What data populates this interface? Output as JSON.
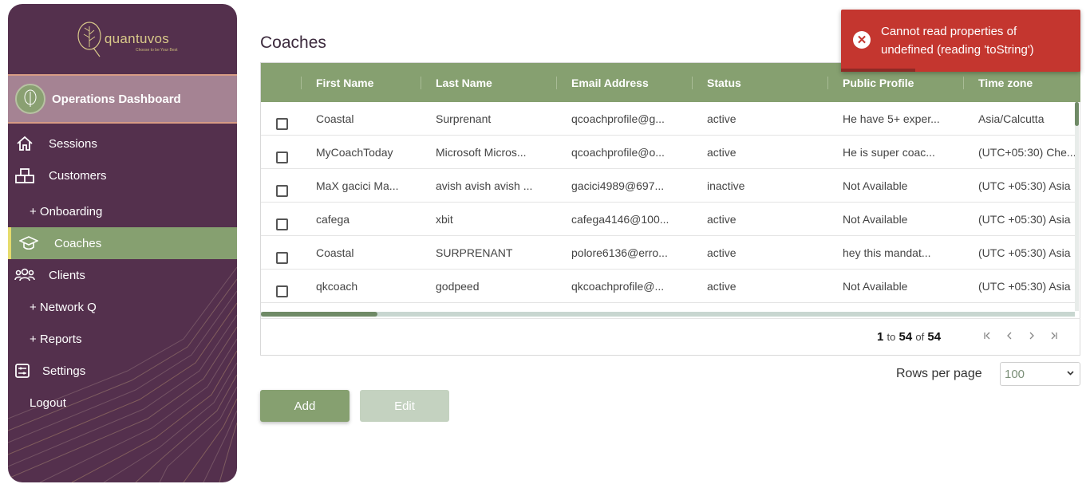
{
  "app": {
    "brand": "quantuvos",
    "tagline": "Choose to be Your Best"
  },
  "sidebar": {
    "dashboard_label": "Operations Dashboard",
    "items": [
      {
        "label": "Sessions",
        "icon": "home-icon"
      },
      {
        "label": "Customers",
        "icon": "building-icon"
      },
      {
        "label": "+ Onboarding",
        "icon": ""
      },
      {
        "label": "Coaches",
        "icon": "graduation-cap-icon"
      },
      {
        "label": "Clients",
        "icon": "users-icon"
      },
      {
        "label": "+ Network Q",
        "icon": ""
      },
      {
        "label": "+ Reports",
        "icon": ""
      },
      {
        "label": "Settings",
        "icon": "settings-icon"
      },
      {
        "label": "Logout",
        "icon": ""
      }
    ]
  },
  "page": {
    "title": "Coaches"
  },
  "table": {
    "columns": [
      "First Name",
      "Last Name",
      "Email Address",
      "Status",
      "Public Profile",
      "Time zone"
    ],
    "rows": [
      [
        "Coastal",
        "Surprenant",
        "qcoachprofile@g...",
        "active",
        "He have 5+ exper...",
        "Asia/Calcutta"
      ],
      [
        "MyCoachToday",
        "Microsoft Micros...",
        "qcoachprofile@o...",
        "active",
        "He is super coac...",
        "(UTC+05:30) Che..."
      ],
      [
        "MaX gacici Ma...",
        "avish avish avish ...",
        "gacici4989@697...",
        "inactive",
        "Not Available",
        "(UTC +05:30) Asia"
      ],
      [
        "cafega",
        "xbit",
        "cafega4146@100...",
        "active",
        "Not Available",
        "(UTC +05:30) Asia"
      ],
      [
        "Coastal",
        "SURPRENANT",
        "polore6136@erro...",
        "active",
        "hey this mandat...",
        "(UTC +05:30) Asia"
      ],
      [
        "qkcoach",
        "godpeed",
        "qkcoachprofile@...",
        "active",
        "Not Available",
        "(UTC +05:30) Asia"
      ]
    ],
    "pager": {
      "from": "1",
      "to_word": "to",
      "to": "54",
      "of_word": "of",
      "total": "54"
    }
  },
  "rows_per_page": {
    "label": "Rows per page",
    "value": "100"
  },
  "buttons": {
    "add": "Add",
    "edit": "Edit"
  },
  "toast": {
    "message": "Cannot read properties of undefined (reading 'toString')"
  },
  "colors": {
    "sidebar_bg": "#54304d",
    "accent_green": "#86a070",
    "error_red": "#c4362f"
  }
}
